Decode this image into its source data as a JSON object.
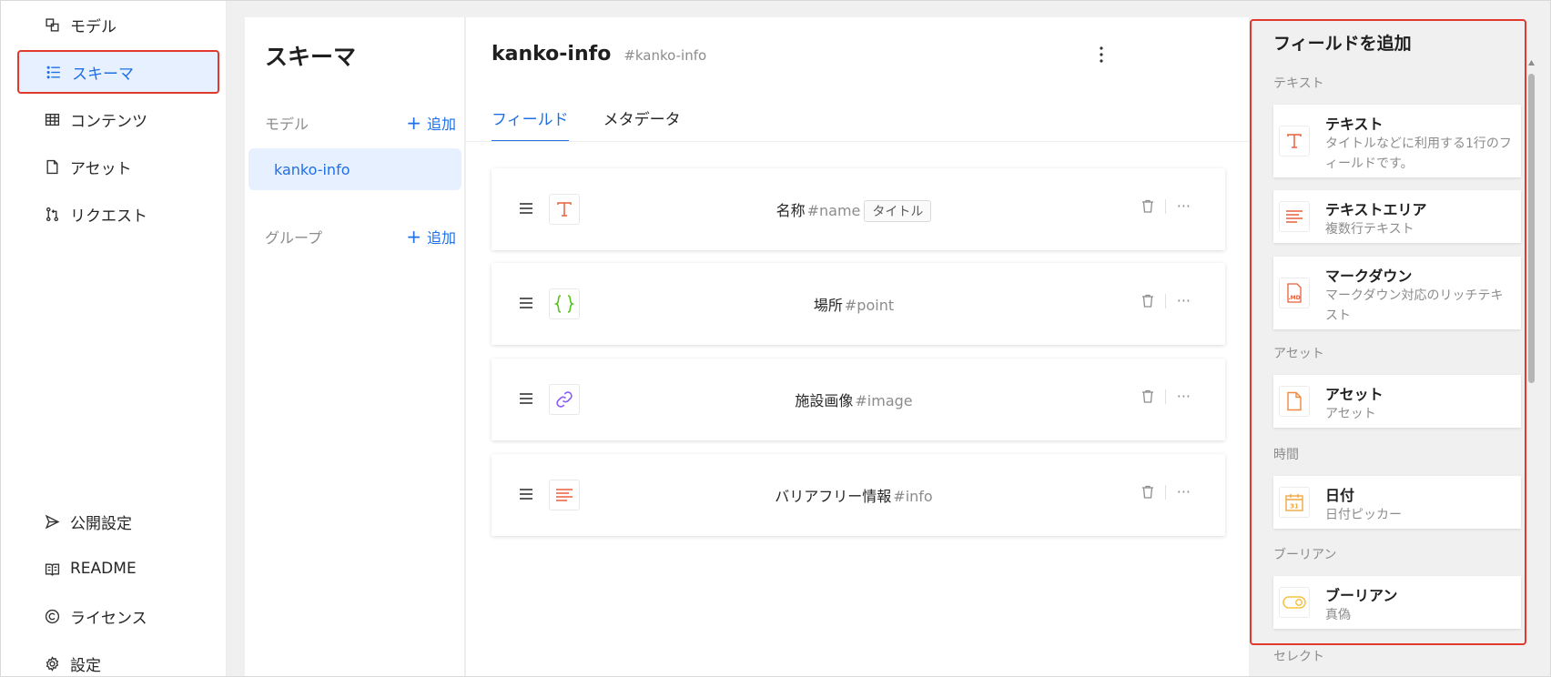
{
  "sidebar": {
    "top_items": [
      {
        "label": "モデル",
        "icon": "model-icon"
      },
      {
        "label": "スキーマ",
        "icon": "list-icon"
      },
      {
        "label": "コンテンツ",
        "icon": "table-icon"
      },
      {
        "label": "アセット",
        "icon": "file-icon"
      },
      {
        "label": "リクエスト",
        "icon": "pull-request-icon"
      }
    ],
    "bottom_items": [
      {
        "label": "公開設定",
        "icon": "send-icon"
      },
      {
        "label": "README",
        "icon": "book-icon"
      },
      {
        "label": "ライセンス",
        "icon": "copyright-icon"
      },
      {
        "label": "設定",
        "icon": "gear-icon"
      }
    ]
  },
  "schema": {
    "title": "スキーマ",
    "model_section": "モデル",
    "group_section": "グループ",
    "add_label": "追加",
    "models": [
      "kanko-info"
    ]
  },
  "main": {
    "title": "kanko-info",
    "key": "#kanko-info",
    "tabs": [
      {
        "label": "フィールド",
        "active": true
      },
      {
        "label": "メタデータ",
        "active": false
      }
    ],
    "fields": [
      {
        "name": "名称",
        "key": "#name",
        "badge": "タイトル",
        "icon": "text-icon"
      },
      {
        "name": "場所",
        "key": "#point",
        "badge": "",
        "icon": "braces-icon"
      },
      {
        "name": "施設画像",
        "key": "#image",
        "badge": "",
        "icon": "link-icon"
      },
      {
        "name": "バリアフリー情報",
        "key": "#info",
        "badge": "",
        "icon": "textarea-icon"
      }
    ],
    "more_label": "···"
  },
  "add_field": {
    "title": "フィールドを追加",
    "categories": {
      "text": "テキスト",
      "asset": "アセット",
      "time": "時間",
      "boolean": "ブーリアン",
      "select": "セレクト"
    },
    "items": {
      "text": {
        "title": "テキスト",
        "desc": "タイトルなどに利用する1行のフィールドです。",
        "icon": "text-icon"
      },
      "textarea": {
        "title": "テキストエリア",
        "desc": "複数行テキスト",
        "icon": "textarea-icon"
      },
      "markdown": {
        "title": "マークダウン",
        "desc": "マークダウン対応のリッチテキスト",
        "icon": "markdown-icon",
        "icon_text": ".MD"
      },
      "asset": {
        "title": "アセット",
        "desc": "アセット",
        "icon": "file-icon"
      },
      "date": {
        "title": "日付",
        "desc": "日付ピッカー",
        "icon": "calendar-icon",
        "icon_text": "31"
      },
      "boolean": {
        "title": "ブーリアン",
        "desc": "真偽",
        "icon": "toggle-icon"
      }
    }
  },
  "colors": {
    "accent": "#1f6fe5",
    "highlight_border": "#e03a2f",
    "text_icon": "#e8603c",
    "braces_icon": "#52c41a",
    "link_icon": "#8a5cf6",
    "asset_icon": "#f0883e",
    "date_icon": "#f0a93e",
    "boolean_icon": "#f5c242"
  }
}
